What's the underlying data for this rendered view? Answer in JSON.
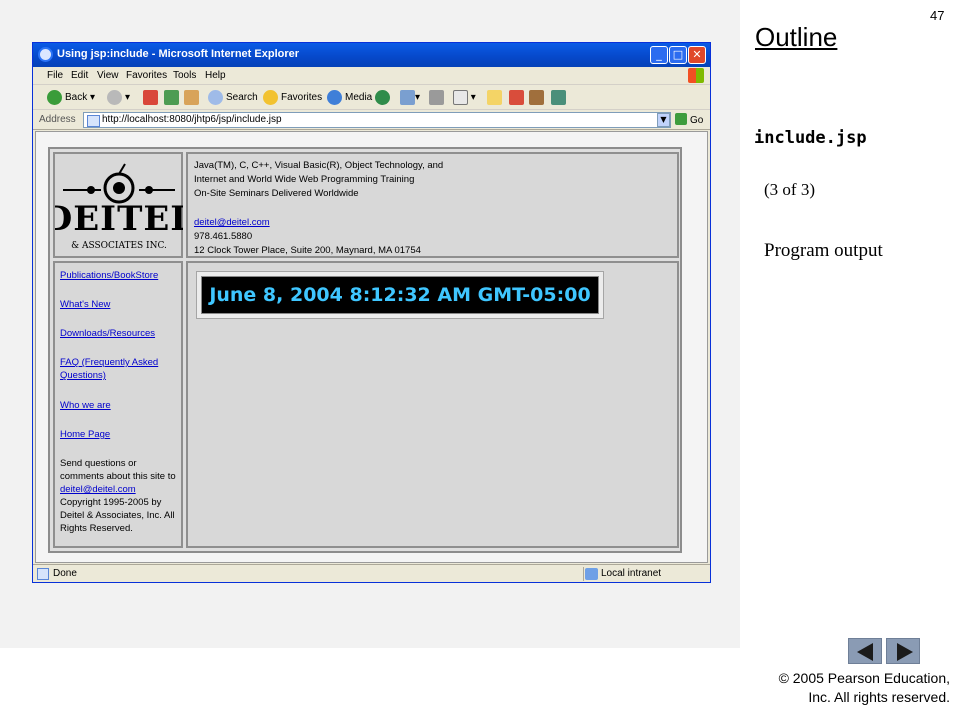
{
  "slide": {
    "page_number": "47",
    "outline_title": "Outline",
    "file_name": "include.jsp",
    "page_count": "(3 of 3)",
    "program_output": "Program output",
    "copyright_line1": "© 2005 Pearson Education,",
    "copyright_line2": "Inc.  All rights reserved."
  },
  "browser": {
    "window_title": "Using jsp:include - Microsoft Internet Explorer",
    "window_buttons": {
      "minimize": "_",
      "maximize": "□",
      "close": "✕"
    },
    "menu": [
      "File",
      "Edit",
      "View",
      "Favorites",
      "Tools",
      "Help"
    ],
    "toolbar": {
      "back": "Back",
      "search": "Search",
      "favorites": "Favorites",
      "media": "Media"
    },
    "address_label": "Address",
    "address_value": "http://localhost:8080/jhtp6/jsp/include.jsp",
    "go_label": "Go",
    "status_text": "Done",
    "zone_text": "Local intranet"
  },
  "page": {
    "logo_text": "DEITEL",
    "logo_subtext": "& ASSOCIATES INC.",
    "info_lines": [
      "Java(TM), C, C++, Visual Basic(R), Object Technology, and",
      "Internet and World Wide Web Programming Training",
      "On-Site Seminars Delivered Worldwide"
    ],
    "email": "deitel@deitel.com",
    "phone": "978.461.5880",
    "address": "12 Clock Tower Place, Suite 200, Maynard, MA 01754",
    "nav_links": [
      "Publications/BookStore",
      "What's New",
      "Downloads/Resources",
      "FAQ (Frequently Asked Questions)",
      "Who we are",
      "Home Page"
    ],
    "contact_text_1": "Send questions or comments about this site to",
    "contact_link": "deitel@deitel.com",
    "contact_text_2": "Copyright 1995-2005 by Deitel & Associates, Inc. All Rights Reserved.",
    "clock_text": "June 8, 2004 8:12:32 AM GMT-05:00"
  },
  "colors": {
    "titlebar": "#0648c9",
    "clock_text": "#3fc6ff",
    "link": "#0000cc"
  }
}
